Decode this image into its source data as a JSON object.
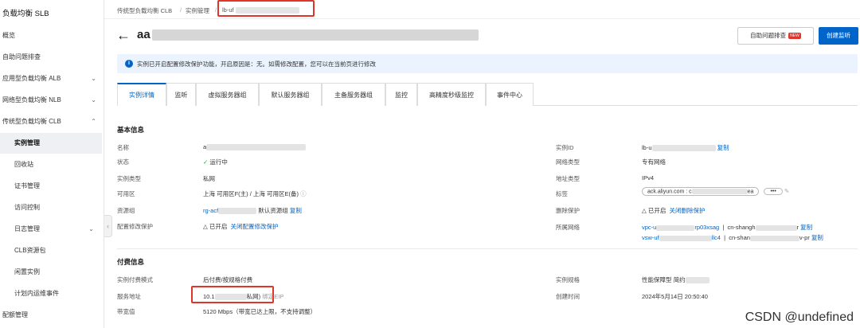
{
  "sidebar": {
    "title": "负载均衡 SLB",
    "items": [
      {
        "label": "概览"
      },
      {
        "label": "自助问题排查"
      },
      {
        "label": "应用型负载均衡 ALB"
      },
      {
        "label": "网络型负载均衡 NLB"
      },
      {
        "label": "传统型负载均衡 CLB"
      },
      {
        "label": "实例管理"
      },
      {
        "label": "回收站"
      },
      {
        "label": "证书管理"
      },
      {
        "label": "访问控制"
      },
      {
        "label": "日志管理"
      },
      {
        "label": "CLB资源包"
      },
      {
        "label": "闲置实例"
      },
      {
        "label": "计划内运维事件"
      },
      {
        "label": "配额管理"
      }
    ]
  },
  "breadcrumb": {
    "c1": "传统型负载均衡 CLB",
    "c2": "实例管理",
    "c3": "lb-uf"
  },
  "header": {
    "title": "aa",
    "auto_check": "自助问题排查",
    "new_badge": "NEW",
    "create_monitor": "创建监听"
  },
  "notice": "实例已开启配置修改保护功能，开启原因是：无。如需修改配置，您可以在当前页进行修改",
  "tabs": [
    "实例详情",
    "监听",
    "虚拟服务器组",
    "默认服务器组",
    "主备服务器组",
    "监控",
    "高精度秒级监控",
    "事件中心"
  ],
  "basic": {
    "title": "基本信息",
    "left": [
      {
        "label": "名称",
        "value": "a"
      },
      {
        "label": "状态",
        "value": "运行中"
      },
      {
        "label": "实例类型",
        "value": "私网"
      },
      {
        "label": "可用区",
        "value": "上海 可用区F(主) / 上海 可用区E(备)"
      },
      {
        "label": "资源组",
        "value": "rg-acf",
        "extra": "默认资源组",
        "link": "复制"
      },
      {
        "label": "配置修改保护",
        "value": "已开启",
        "link": "关闭配置修改保护"
      }
    ],
    "right": [
      {
        "label": "实例ID",
        "value": "lb-u",
        "link": "复制"
      },
      {
        "label": "网络类型",
        "value": "专有网络"
      },
      {
        "label": "地址类型",
        "value": "IPv4"
      },
      {
        "label": "标签",
        "value": "ack.aliyun.com : c",
        "suffix": "ea",
        "more": "•••"
      },
      {
        "label": "删除保护",
        "value": "已开启",
        "link": "关闭删除保护"
      },
      {
        "label": "所属网络",
        "vpc": "vpc-u",
        "vpc_tail": "rp03xsag",
        "vpc_region": "cn-shangh",
        "vpc_region_tail": "r",
        "vsw": "vsw-uf",
        "vsw_tail": "llc4",
        "vsw_region": "cn-shan",
        "vsw_region_tail": "v-pr",
        "link": "复制"
      }
    ]
  },
  "billing": {
    "title": "付费信息",
    "left": [
      {
        "label": "实例付费模式",
        "value": "后付费/按规格付费"
      },
      {
        "label": "服务地址",
        "value": "10.1",
        "value_tail": "私网)",
        "extra": "绑定EIP"
      },
      {
        "label": "带宽值",
        "value": "5120 Mbps（带宽已达上限，不支持调整）"
      }
    ],
    "right": [
      {
        "label": "实例规格",
        "value": "性能保障型",
        "value2": "简约"
      },
      {
        "label": "创建时间",
        "value": "2024年5月14日 20:50:40"
      }
    ]
  },
  "watermark": "CSDN @undefined"
}
